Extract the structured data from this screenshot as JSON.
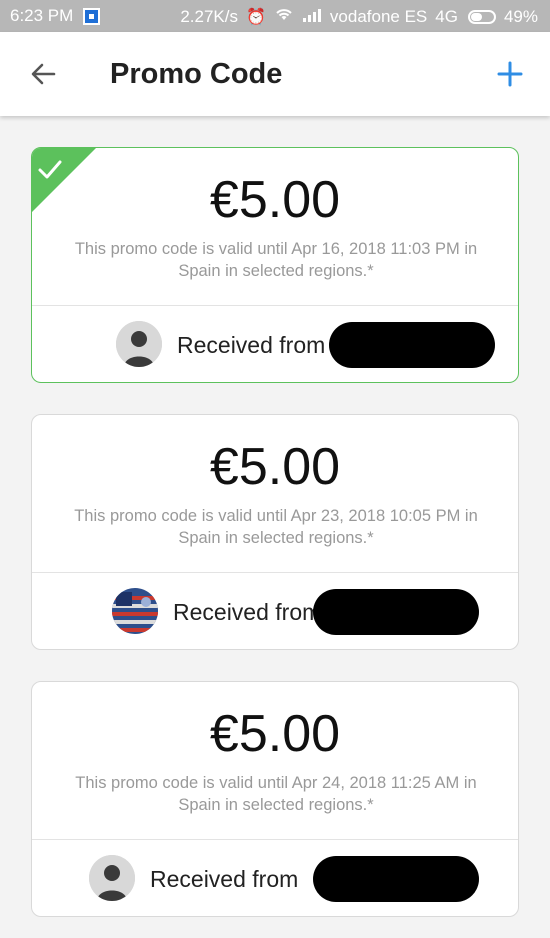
{
  "status_bar": {
    "time": "6:23 PM",
    "speed": "2.27K/s",
    "carrier": "vodafone ES",
    "network": "4G",
    "battery": "49%",
    "battery_level": 0.49
  },
  "header": {
    "title": "Promo Code",
    "back_icon": "arrow-left-icon",
    "add_icon": "plus-icon"
  },
  "colors": {
    "accent": "#2f8de4",
    "selected": "#5cc15c"
  },
  "promo_codes": [
    {
      "amount": "€5.00",
      "validity": "This promo code is valid until Apr 16, 2018 11:03 PM in Spain in selected regions.*",
      "received_label": "Received from",
      "selected": true
    },
    {
      "amount": "€5.00",
      "validity": "This promo code is valid until Apr 23, 2018 10:05 PM in Spain in selected regions.*",
      "received_label": "Received from",
      "selected": false
    },
    {
      "amount": "€5.00",
      "validity": "This promo code is valid until Apr 24, 2018 11:25 AM in Spain in selected regions.*",
      "received_label": "Received from",
      "selected": false
    }
  ]
}
